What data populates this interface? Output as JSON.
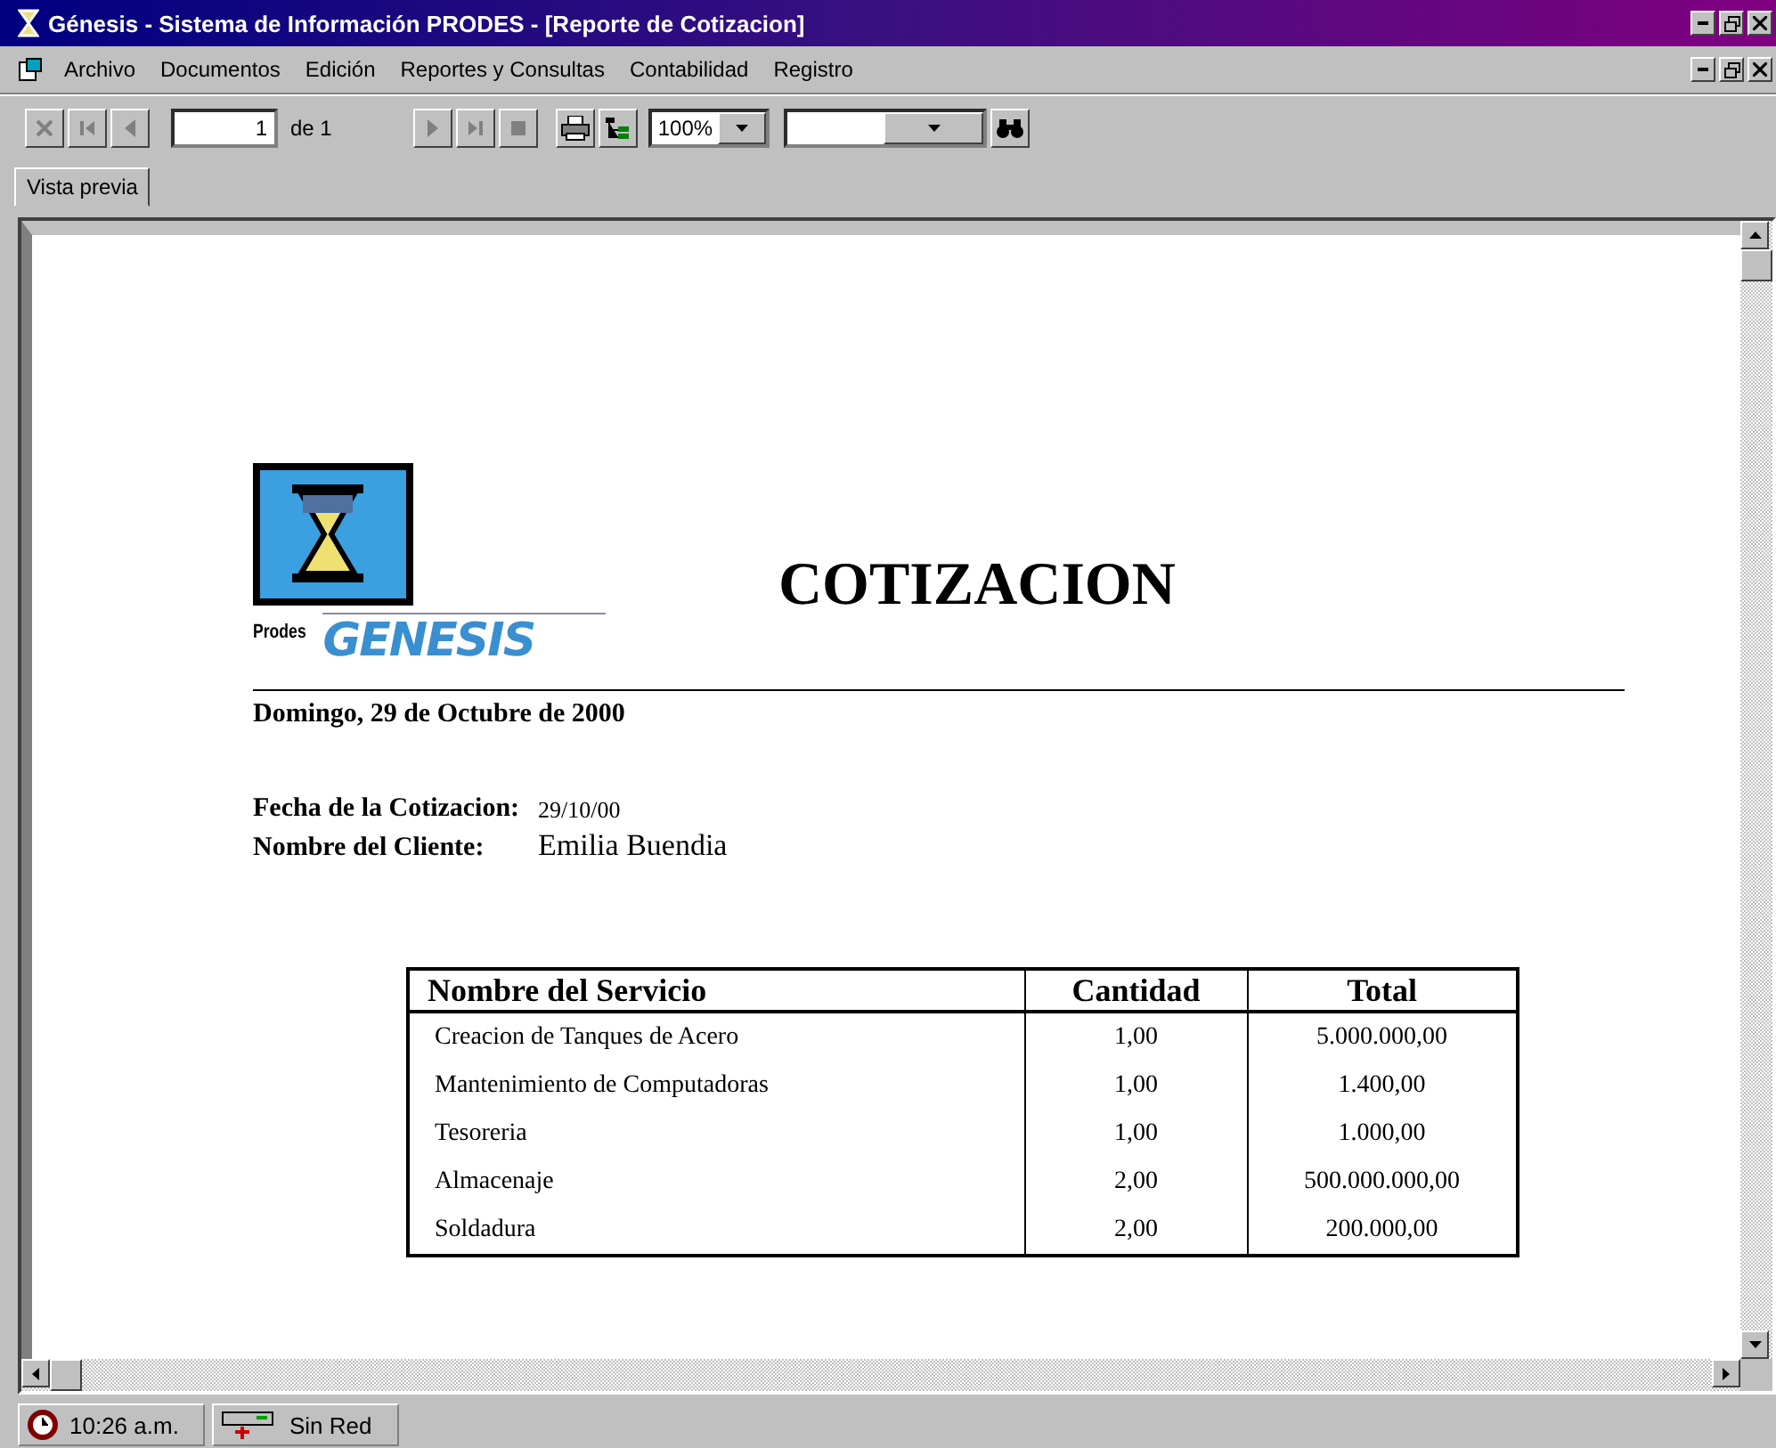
{
  "window": {
    "title": "Génesis - Sistema de Información PRODES - [Reporte de Cotizacion]"
  },
  "menu": [
    {
      "label": "Archivo"
    },
    {
      "label": "Documentos"
    },
    {
      "label": "Edición"
    },
    {
      "label": "Reportes y Consultas"
    },
    {
      "label": "Contabilidad"
    },
    {
      "label": "Registro"
    }
  ],
  "toolbar": {
    "buttons_left": [
      {
        "kind": "close",
        "disabled": true
      },
      {
        "kind": "first",
        "disabled": true
      },
      {
        "kind": "prev",
        "disabled": true
      }
    ],
    "page_field": {
      "value": "1"
    },
    "page_count": "de 1",
    "buttons_mid": [
      {
        "kind": "next",
        "disabled": true
      },
      {
        "kind": "last",
        "disabled": true
      },
      {
        "kind": "stop",
        "disabled": true
      },
      {
        "kind": "print",
        "disabled": false
      },
      {
        "kind": "tree",
        "disabled": false
      }
    ],
    "zoom": {
      "value": "100%"
    }
  },
  "tabs": [
    {
      "label": "Vista previa",
      "selected": true
    }
  ],
  "report": {
    "logo": {
      "small": "Prodes",
      "large": "GENESIS"
    },
    "title": "COTIZACION",
    "date": "Domingo, 29 de Octubre de 2000",
    "fields": [
      {
        "label": "Fecha de la Cotizacion:",
        "value": "29/10/00",
        "kind": "small"
      },
      {
        "label": "Nombre del Cliente:",
        "value": "Emilia Buendia",
        "kind": "large"
      }
    ],
    "table": {
      "columns": [
        "Nombre del Servicio",
        "Cantidad",
        "Total"
      ],
      "rows": [
        [
          "Creacion de Tanques de Acero",
          "1,00",
          "5.000.000,00"
        ],
        [
          "Mantenimiento de Computadoras",
          "1,00",
          "1.400,00"
        ],
        [
          "Tesoreria",
          "1,00",
          "1.000,00"
        ],
        [
          "Almacenaje",
          "2,00",
          "500.000.000,00"
        ],
        [
          "Soldadura",
          "2,00",
          "200.000,00"
        ]
      ]
    }
  },
  "status_bar": [
    {
      "kind": "clock",
      "text": "10:26 a.m."
    },
    {
      "kind": "network",
      "text": "Sin Red"
    }
  ]
}
